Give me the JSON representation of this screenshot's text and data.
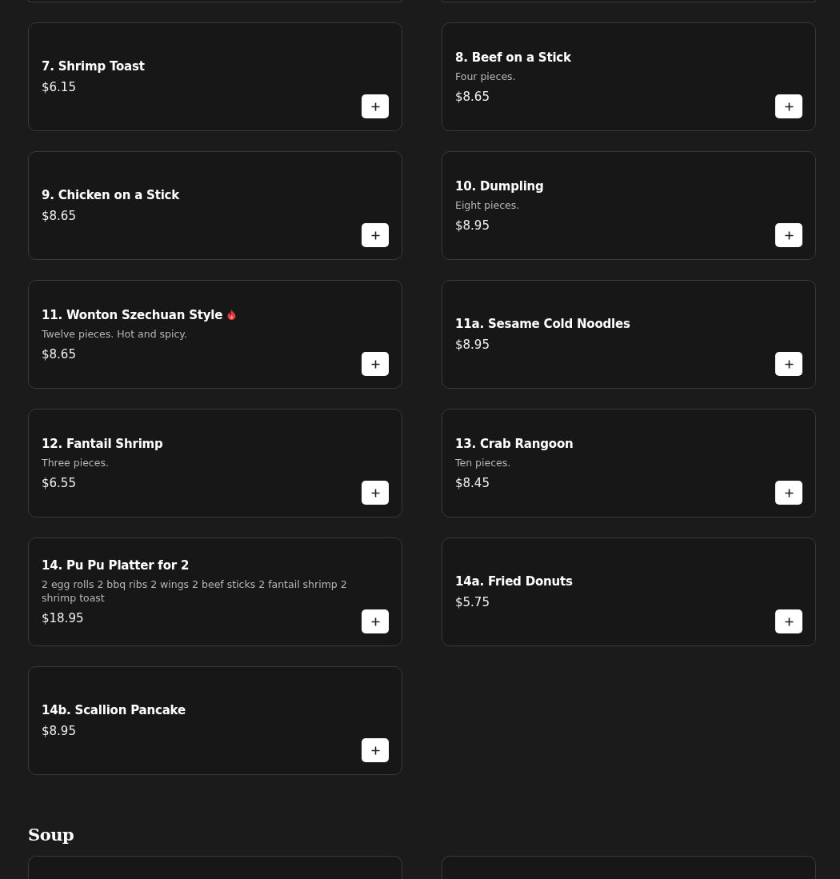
{
  "rows": [
    {
      "items": [
        {
          "name": "7. Shrimp Toast",
          "price": "$6.15",
          "spicy": false
        },
        {
          "name": "8. Beef on a Stick",
          "description": "Four pieces.",
          "price": "$8.65",
          "spicy": false
        }
      ]
    },
    {
      "items": [
        {
          "name": "9. Chicken on a Stick",
          "price": "$8.65",
          "spicy": false
        },
        {
          "name": "10. Dumpling",
          "description": "Eight pieces.",
          "price": "$8.95",
          "spicy": false
        }
      ]
    },
    {
      "items": [
        {
          "name": "11. Wonton Szechuan Style",
          "description": "Twelve pieces. Hot and spicy.",
          "price": "$8.65",
          "spicy": true
        },
        {
          "name": "11a. Sesame Cold Noodles",
          "price": "$8.95",
          "spicy": false
        }
      ]
    },
    {
      "items": [
        {
          "name": "12. Fantail Shrimp",
          "description": "Three pieces.",
          "price": "$6.55",
          "spicy": false
        },
        {
          "name": "13. Crab Rangoon",
          "description": "Ten pieces.",
          "price": "$8.45",
          "spicy": false
        }
      ]
    },
    {
      "items": [
        {
          "name": "14. Pu Pu Platter for 2",
          "description": "2 egg rolls 2 bbq ribs 2 wings 2 beef sticks 2 fantail shrimp 2 shrimp toast",
          "price": "$18.95",
          "spicy": false
        },
        {
          "name": "14a. Fried Donuts",
          "price": "$5.75",
          "spicy": false
        }
      ]
    },
    {
      "items": [
        {
          "name": "14b. Scallion Pancake",
          "price": "$8.95",
          "spicy": false
        }
      ]
    }
  ],
  "next_section": {
    "title": "Soup"
  }
}
